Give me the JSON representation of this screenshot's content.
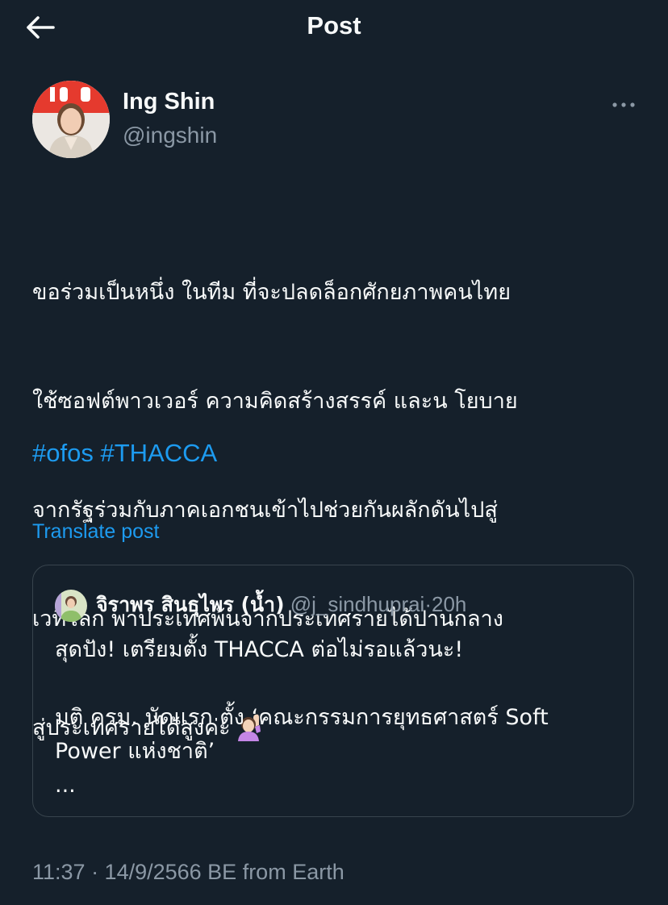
{
  "header": {
    "title": "Post",
    "back_icon": "arrow-left-icon"
  },
  "author": {
    "name": "Ing Shin",
    "handle": "@ingshin",
    "more_icon": "more-horizontal-icon"
  },
  "post": {
    "lines": [
      "ขอร่วมเป็นหนึ่ง ในทีม ที่จะปลดล็อกศักยภาพคนไทย",
      "ใช้ซอฟต์พาวเวอร์ ความคิดสร้างสรรค์ และน โยบาย",
      "จากรัฐร่วมกับภาคเอกชนเข้าไปช่วยกันผลักดันไปสู่",
      "เวทีโลก พาประเทศพ้นจากประเทศรายได้ปานกลาง",
      "สู่ประเทศรายได้สูงค่ะ"
    ],
    "emoji": "person-raising-hand-emoji",
    "hashtags": [
      "#ofos",
      "#THACCA"
    ],
    "translate_label": "Translate post"
  },
  "quote": {
    "name": "จิราพร สินธุไพร (น้ำ)",
    "handle": "@j_sindhuprai",
    "dot": "·",
    "time": "20h",
    "lines": [
      "สุดปัง! เตรียมตั้ง THACCA ต่อไม่รอแล้วนะ!",
      "",
      "มติ ครม. นัดแรก ตั้ง ‘คณะกรรมการยุทธศาสตร์ Soft",
      "Power แห่งชาติ’",
      "..."
    ]
  },
  "meta": {
    "timestamp": "11:37 · 14/9/2566 BE from Earth"
  },
  "colors": {
    "background": "#15202b",
    "text": "#f7f9f9",
    "secondary": "#8b98a5",
    "accent": "#1d9bf0",
    "border": "#38444d"
  }
}
